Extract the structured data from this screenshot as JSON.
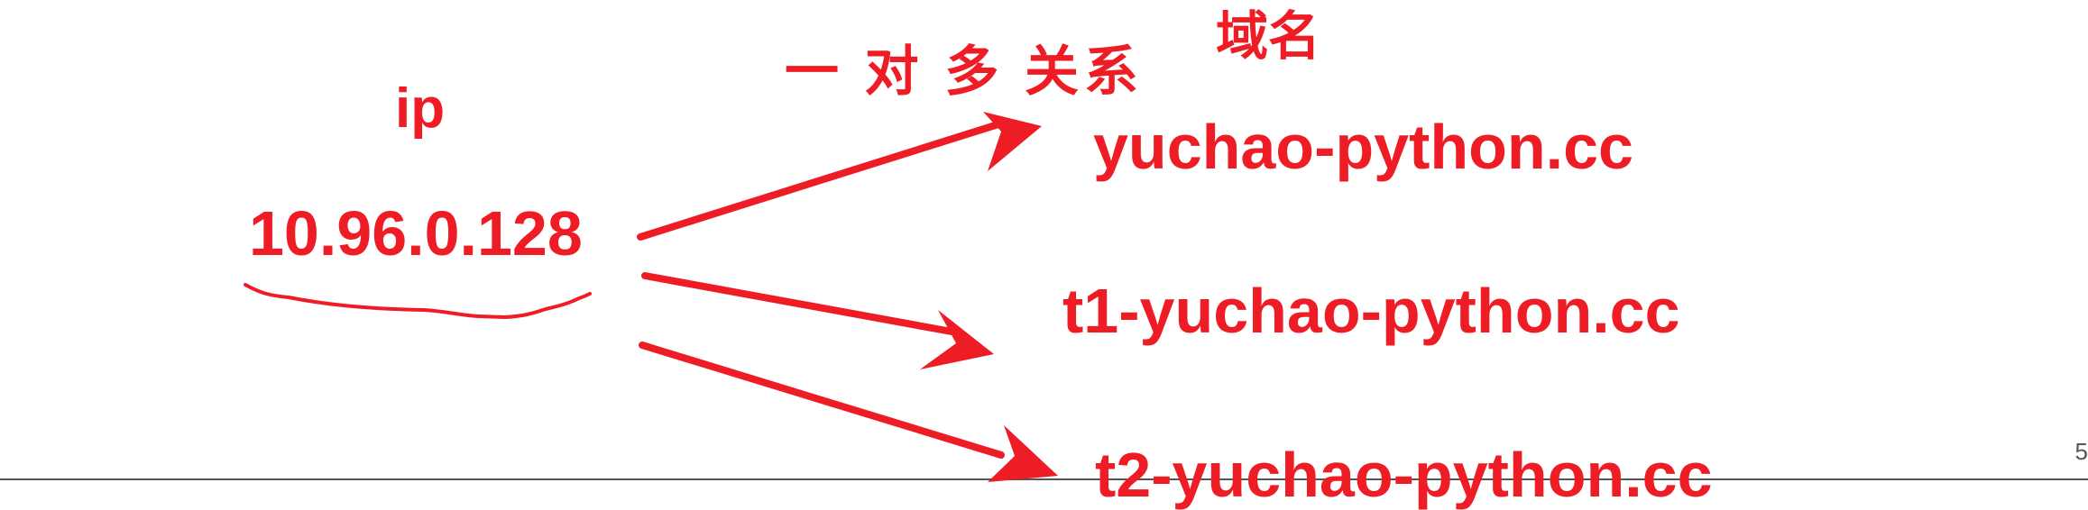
{
  "colors": {
    "accent": "#ee1c25",
    "footer_line": "#555555"
  },
  "diagram": {
    "ip_label": "ip",
    "ip_address": "10.96.0.128",
    "relation_label": "一 对 多 关系",
    "domain_label": "域名",
    "domains": [
      "yuchao-python.cc",
      "t1-yuchao-python.cc",
      "t2-yuchao-python.cc"
    ]
  },
  "footer": {
    "left_text": "",
    "page_number": "5"
  }
}
